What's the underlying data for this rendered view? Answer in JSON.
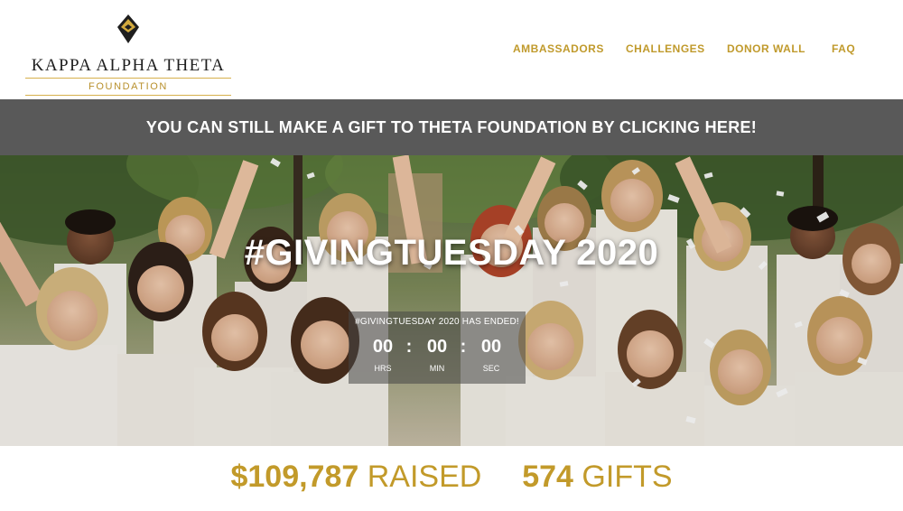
{
  "brand": {
    "name": "KAPPA ALPHA THETA",
    "sub": "FOUNDATION",
    "gold": "#c09a2c"
  },
  "nav": {
    "items": [
      {
        "label": "AMBASSADORS"
      },
      {
        "label": "CHALLENGES"
      },
      {
        "label": "DONOR WALL"
      },
      {
        "label": "FAQ"
      }
    ]
  },
  "banner": {
    "text": "YOU CAN STILL MAKE A GIFT TO THETA FOUNDATION BY CLICKING HERE!",
    "bg": "#595959"
  },
  "hero": {
    "title": "#GIVINGTUESDAY 2020",
    "image": "group-photo-confetti"
  },
  "countdown": {
    "ended_text": "#GIVINGTUESDAY 2020 HAS ENDED!",
    "hours": "00",
    "minutes": "00",
    "seconds": "00",
    "sep": ":",
    "hours_label": "HRS",
    "minutes_label": "MIN",
    "seconds_label": "SEC"
  },
  "stats": {
    "raised_value": "$109,787",
    "raised_label": "RAISED",
    "gifts_value": "574",
    "gifts_label": "GIFTS"
  }
}
